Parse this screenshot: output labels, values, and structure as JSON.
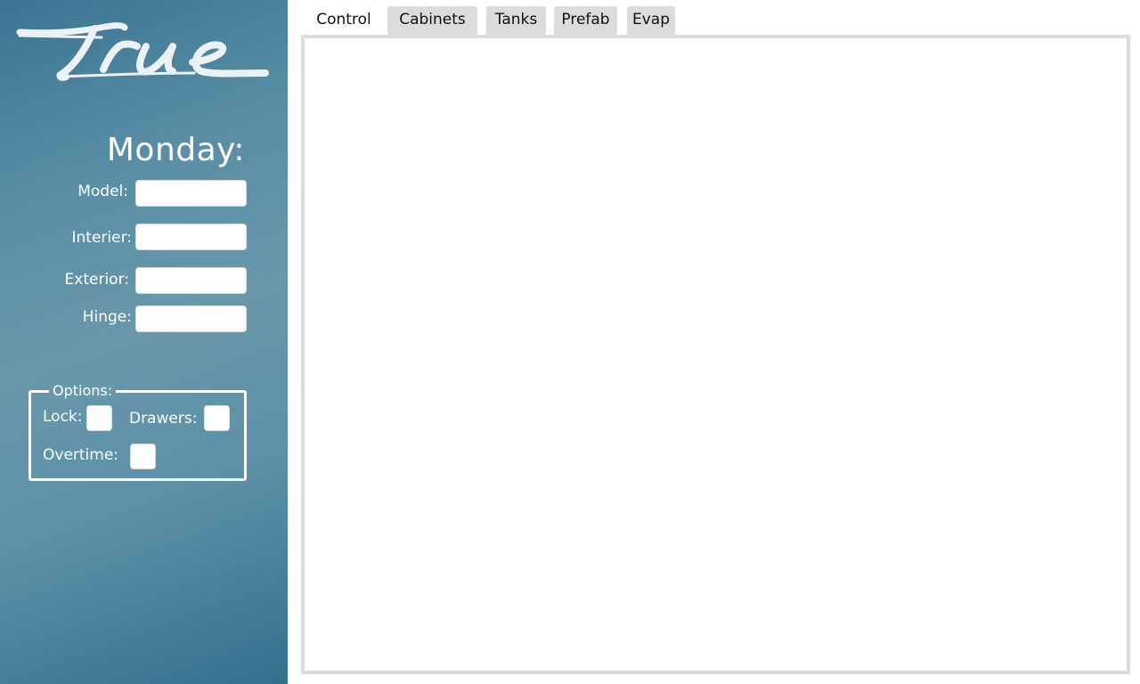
{
  "brand": {
    "logo_text": "true"
  },
  "sidebar": {
    "day_title": "Monday:",
    "fields": {
      "model": {
        "label": "Model:",
        "value": "",
        "placeholder": ""
      },
      "interior": {
        "label": "Interier:",
        "value": "",
        "placeholder": ""
      },
      "exterior": {
        "label": "Exterior:",
        "value": "",
        "placeholder": ""
      },
      "hinge": {
        "label": "Hinge:",
        "value": "",
        "placeholder": ""
      }
    },
    "options": {
      "legend": "Options:",
      "lock_label": "Lock:",
      "drawers_label": "Drawers:",
      "overtime_label": "Overtime:"
    }
  },
  "tabs": [
    {
      "label": "Control",
      "active": true
    },
    {
      "label": "Cabinets",
      "active": false
    },
    {
      "label": "Tanks",
      "active": false
    },
    {
      "label": "Prefab",
      "active": false
    },
    {
      "label": "Evap",
      "active": false
    }
  ],
  "colors": {
    "sidebar_gradient_mid": "#6897aa",
    "sidebar_gradient_edge": "#33708d",
    "tab_inactive": "#dcdcdc",
    "panel_border": "#dcdcdc"
  }
}
